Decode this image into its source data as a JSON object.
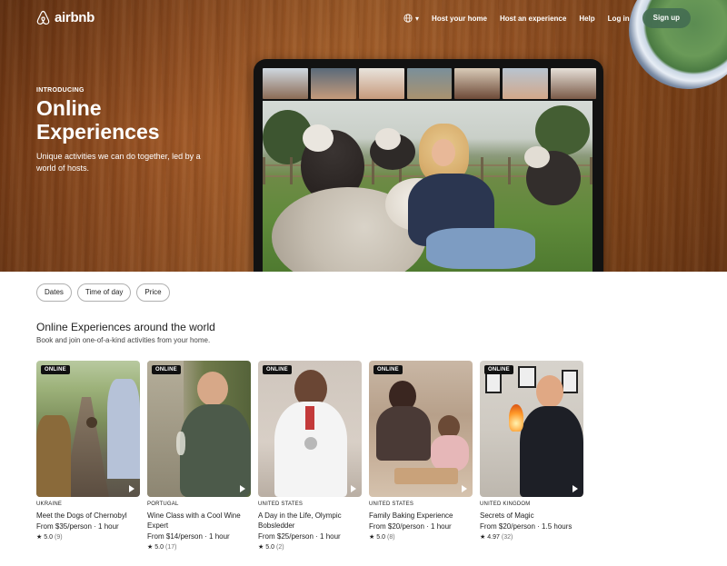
{
  "nav": {
    "logo_text": "airbnb",
    "links": [
      "Host your home",
      "Host an experience",
      "Help",
      "Log in"
    ],
    "signup_label": "Sign up"
  },
  "hero": {
    "eyebrow": "INTRODUCING",
    "title": "Online Experiences",
    "subtitle": "Unique activities we can do together, led by a world of hosts."
  },
  "filters": [
    "Dates",
    "Time of day",
    "Price"
  ],
  "section": {
    "title": "Online Experiences around the world",
    "subtitle": "Book and join one-of-a-kind activities from your home."
  },
  "cards": [
    {
      "badge": "ONLINE",
      "country": "UKRAINE",
      "title": "Meet the Dogs of Chernobyl",
      "price": "From $35/person · 1 hour",
      "rating": "5.0",
      "reviews": "(9)"
    },
    {
      "badge": "ONLINE",
      "country": "PORTUGAL",
      "title": "Wine Class with a Cool Wine Expert",
      "price": "From $14/person · 1 hour",
      "rating": "5.0",
      "reviews": "(17)"
    },
    {
      "badge": "ONLINE",
      "country": "UNITED STATES",
      "title": "A Day in the Life, Olympic Bobsledder",
      "price": "From $25/person · 1 hour",
      "rating": "5.0",
      "reviews": "(2)"
    },
    {
      "badge": "ONLINE",
      "country": "UNITED STATES",
      "title": "Family Baking Experience",
      "price": "From $20/person · 1 hour",
      "rating": "5.0",
      "reviews": "(8)"
    },
    {
      "badge": "ONLINE",
      "country": "UNITED KINGDOM",
      "title": "Secrets of Magic",
      "price": "From $20/person · 1.5 hours",
      "rating": "4.97",
      "reviews": "(32)"
    }
  ],
  "colors": {
    "signup_bg": "#446e52",
    "wood": "#9a5323",
    "text": "#222222",
    "muted": "#717171"
  }
}
